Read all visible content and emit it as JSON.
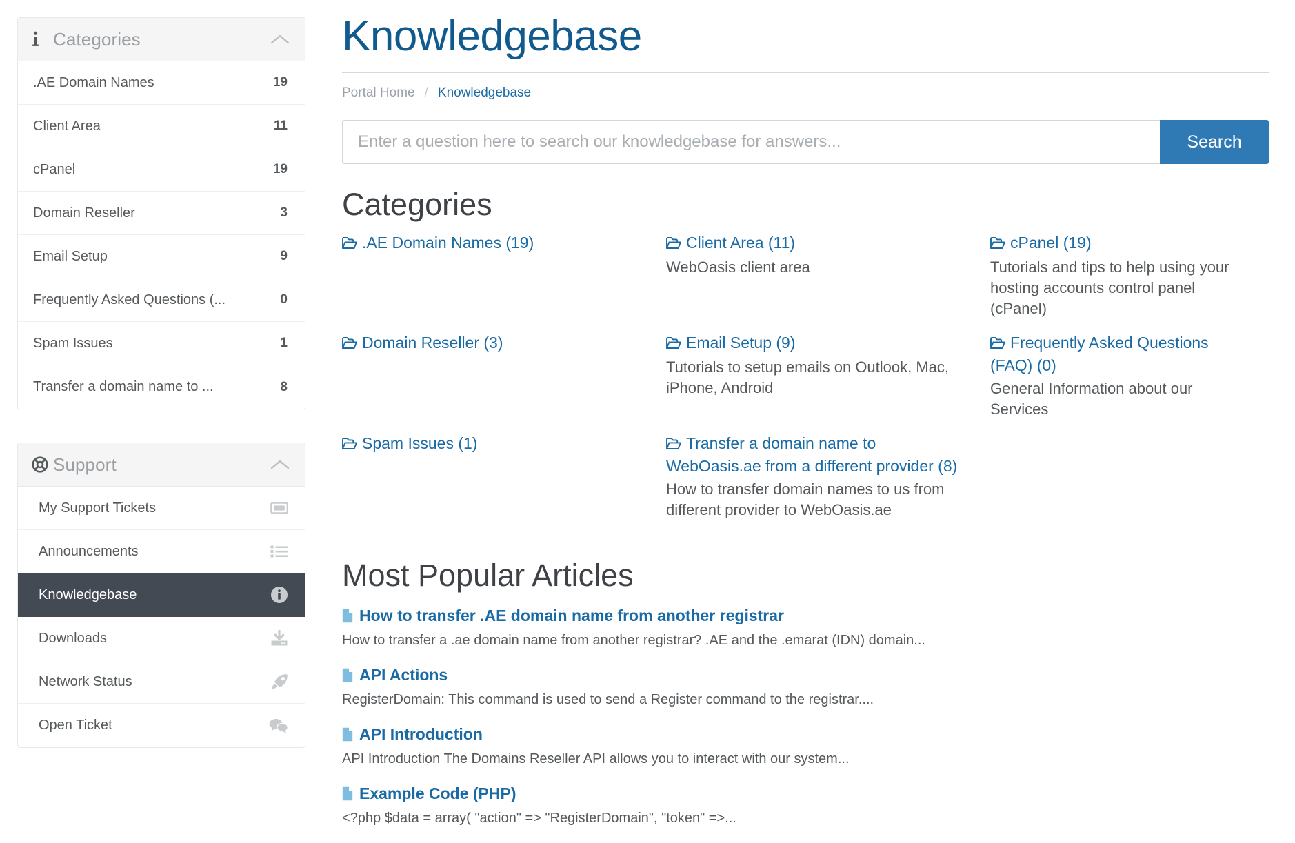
{
  "sidebar": {
    "categories_panel": {
      "icon": "info-icon",
      "title": "Categories",
      "collapse_icon": "chevron-up-icon",
      "items": [
        {
          "label": ".AE Domain Names",
          "count": "19"
        },
        {
          "label": "Client Area",
          "count": "11"
        },
        {
          "label": "cPanel",
          "count": "19"
        },
        {
          "label": "Domain Reseller",
          "count": "3"
        },
        {
          "label": "Email Setup",
          "count": "9"
        },
        {
          "label": "Frequently Asked Questions (...",
          "count": "0"
        },
        {
          "label": "Spam Issues",
          "count": "1"
        },
        {
          "label": "Transfer a domain name to ...",
          "count": "8"
        }
      ]
    },
    "support_panel": {
      "icon": "life-ring-icon",
      "title": "Support",
      "collapse_icon": "chevron-up-icon",
      "items": [
        {
          "label": "My Support Tickets",
          "icon": "ticket-icon",
          "active": false
        },
        {
          "label": "Announcements",
          "icon": "list-icon",
          "active": false
        },
        {
          "label": "Knowledgebase",
          "icon": "info-circle-icon",
          "active": true
        },
        {
          "label": "Downloads",
          "icon": "download-icon",
          "active": false
        },
        {
          "label": "Network Status",
          "icon": "rocket-icon",
          "active": false
        },
        {
          "label": "Open Ticket",
          "icon": "comments-icon",
          "active": false
        }
      ]
    }
  },
  "main": {
    "page_title": "Knowledgebase",
    "breadcrumb": {
      "home": "Portal Home",
      "separator": "/",
      "current": "Knowledgebase"
    },
    "search": {
      "placeholder": "Enter a question here to search our knowledgebase for answers...",
      "value": "",
      "button_label": "Search"
    },
    "categories_heading": "Categories",
    "categories": [
      {
        "title": ".AE Domain Names (19)",
        "desc": ""
      },
      {
        "title": "Client Area (11)",
        "desc": "WebOasis client area"
      },
      {
        "title": "cPanel (19)",
        "desc": "Tutorials and tips to help using your hosting accounts control panel (cPanel)"
      },
      {
        "title": "Domain Reseller (3)",
        "desc": ""
      },
      {
        "title": "Email Setup (9)",
        "desc": "Tutorials to setup emails on Outlook, Mac, iPhone, Android"
      },
      {
        "title": "Frequently Asked Questions (FAQ) (0)",
        "desc": "General Information about our Services"
      },
      {
        "title": "Spam Issues (1)",
        "desc": ""
      },
      {
        "title": "Transfer a domain name to WebOasis.ae from a different provider (8)",
        "desc": "How to transfer domain names to us from different provider to WebOasis.ae"
      },
      {
        "title": "",
        "desc": ""
      }
    ],
    "popular_heading": "Most Popular Articles",
    "articles": [
      {
        "title": "How to transfer .AE domain name from another registrar",
        "snippet": "How to transfer a .ae domain name from another registrar?   .AE and the .emarat (IDN) domain..."
      },
      {
        "title": "API Actions",
        "snippet": "RegisterDomain: This command is used to send a Register command to the registrar...."
      },
      {
        "title": "API Introduction",
        "snippet": "API Introduction The Domains Reseller API allows you to interact with our system..."
      },
      {
        "title": "Example Code (PHP)",
        "snippet": "<?php $data = array( \"action\" => \"RegisterDomain\", \"token\" =>..."
      }
    ]
  },
  "colors": {
    "title_blue": "#105a8e",
    "link_blue": "#1a6ba5",
    "button_blue": "#2f7ab5",
    "active_dark": "#434a54",
    "file_icon_blue": "#7fbde0"
  }
}
